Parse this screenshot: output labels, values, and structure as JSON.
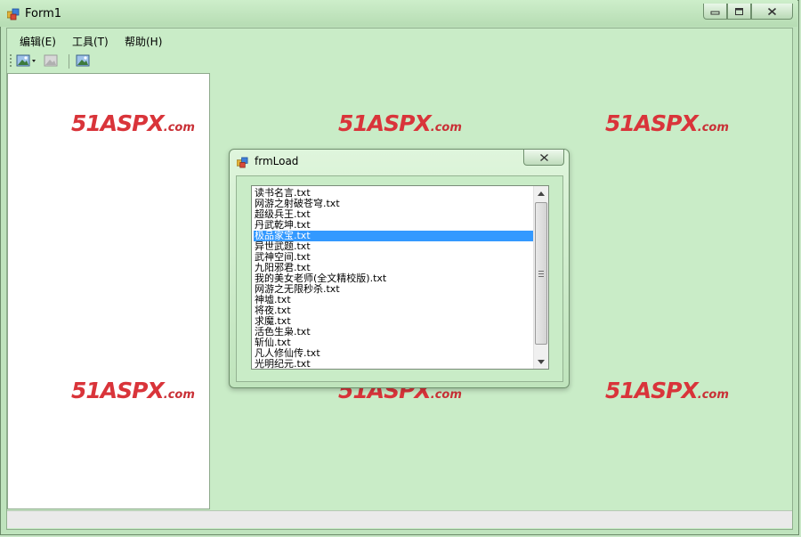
{
  "window": {
    "title": "Form1",
    "icon": "app-window-icon"
  },
  "caption_buttons": {
    "minimize": "minimize-icon",
    "maximize": "maximize-icon",
    "close": "close-icon"
  },
  "menu": [
    {
      "label": "编辑(E)"
    },
    {
      "label": "工具(T)"
    },
    {
      "label": "帮助(H)"
    }
  ],
  "toolbar": [
    {
      "icon": "image-dropdown-icon"
    },
    {
      "icon": "image-disabled-icon"
    },
    {
      "icon": "image-icon"
    }
  ],
  "watermark": {
    "logo": "51Aspx.com"
  },
  "dialog": {
    "title": "frmLoad",
    "list": {
      "items": [
        "读书名言.txt",
        "网游之射破苍穹.txt",
        "超级兵王.txt",
        "丹武乾坤.txt",
        "极品家宝.txt",
        "异世武题.txt",
        "武神空间.txt",
        "九阳邪君.txt",
        "我的美女老师(全文精校版).txt",
        "网游之无限秒杀.txt",
        "神墟.txt",
        "将夜.txt",
        "求魔.txt",
        "活色生枭.txt",
        "斩仙.txt",
        "凡人修仙传.txt",
        "光明纪元.txt"
      ],
      "selected_index": 4,
      "scroll_position": 0.0
    }
  },
  "colors": {
    "selection": "#3399ff",
    "logo_red": "#d9343a",
    "background": "#c9ecc7"
  }
}
